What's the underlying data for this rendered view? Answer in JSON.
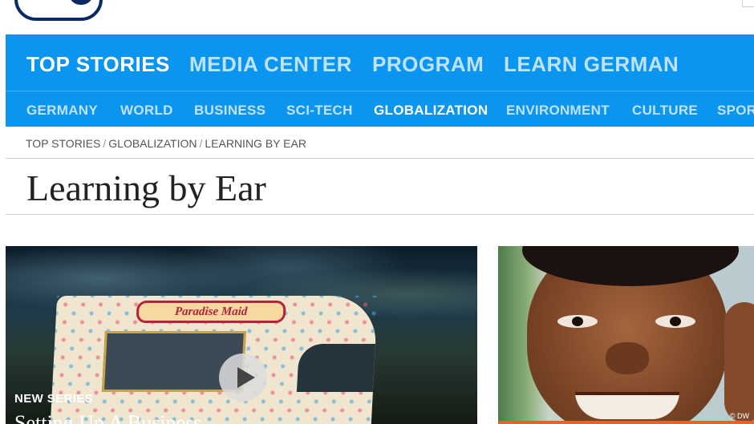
{
  "nav": {
    "main": [
      {
        "label": "TOP STORIES",
        "active": true
      },
      {
        "label": "MEDIA CENTER",
        "active": false
      },
      {
        "label": "PROGRAM",
        "active": false
      },
      {
        "label": "LEARN GERMAN",
        "active": false
      }
    ],
    "sub": [
      {
        "label": "GERMANY",
        "active": false
      },
      {
        "label": "WORLD",
        "active": false
      },
      {
        "label": "BUSINESS",
        "active": false
      },
      {
        "label": "SCI-TECH",
        "active": false
      },
      {
        "label": "GLOBALIZATION",
        "active": true
      },
      {
        "label": "ENVIRONMENT",
        "active": false
      },
      {
        "label": "CULTURE",
        "active": false
      },
      {
        "label": "SPOR",
        "active": false
      }
    ]
  },
  "breadcrumb": [
    "TOP STORIES",
    "GLOBALIZATION",
    "LEARNING BY EAR"
  ],
  "breadcrumb_separator": "/",
  "page_title": "Learning by Ear",
  "feature": {
    "truck_sign": "Paradise Maid",
    "badge": "NEW SERIES",
    "title": "Setting Up A Business"
  },
  "photo_credit": "© DW",
  "colors": {
    "nav_blue": "#0a96f0",
    "nav_text_inactive": "#bfe3ff",
    "nav_text_active": "#ffffff",
    "logo_navy": "#0a2a66",
    "accent_orange": "#e4632a"
  },
  "icons": [
    "dw-logo-icon",
    "play-icon"
  ]
}
